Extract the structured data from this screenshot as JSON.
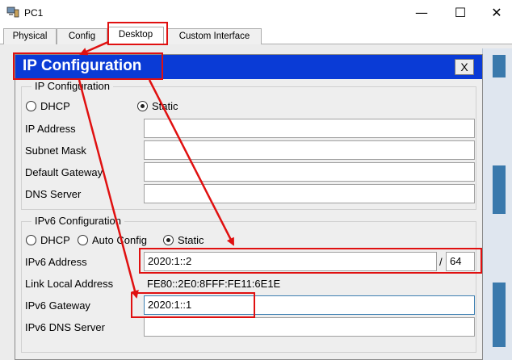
{
  "window": {
    "title": "PC1",
    "minimize_glyph": "—",
    "maximize_glyph": "☐",
    "close_glyph": "✕"
  },
  "tabs": [
    {
      "label": "Physical"
    },
    {
      "label": "Config"
    },
    {
      "label": "Desktop"
    },
    {
      "label": "Custom Interface"
    }
  ],
  "dialog": {
    "title": "IP Configuration",
    "close_label": "X",
    "ipv4": {
      "legend": "IP Configuration",
      "dhcp_label": "DHCP",
      "static_label": "Static",
      "mode": "Static",
      "ip_address_label": "IP Address",
      "ip_address": "",
      "subnet_mask_label": "Subnet Mask",
      "subnet_mask": "",
      "default_gateway_label": "Default Gateway",
      "default_gateway": "",
      "dns_server_label": "DNS Server",
      "dns_server": ""
    },
    "ipv6": {
      "legend": "IPv6 Configuration",
      "dhcp_label": "DHCP",
      "auto_config_label": "Auto Config",
      "static_label": "Static",
      "mode": "Static",
      "address_label": "IPv6 Address",
      "address": "2020:1::2",
      "prefix_separator": "/",
      "prefix_length": "64",
      "link_local_label": "Link Local Address",
      "link_local": "FE80::2E0:8FFF:FE11:6E1E",
      "gateway_label": "IPv6 Gateway",
      "gateway": "2020:1::1",
      "dns_label": "IPv6 DNS Server",
      "dns": ""
    }
  },
  "colors": {
    "dialog_title_bg": "#0a3bd6",
    "annotation": "#e01010"
  }
}
